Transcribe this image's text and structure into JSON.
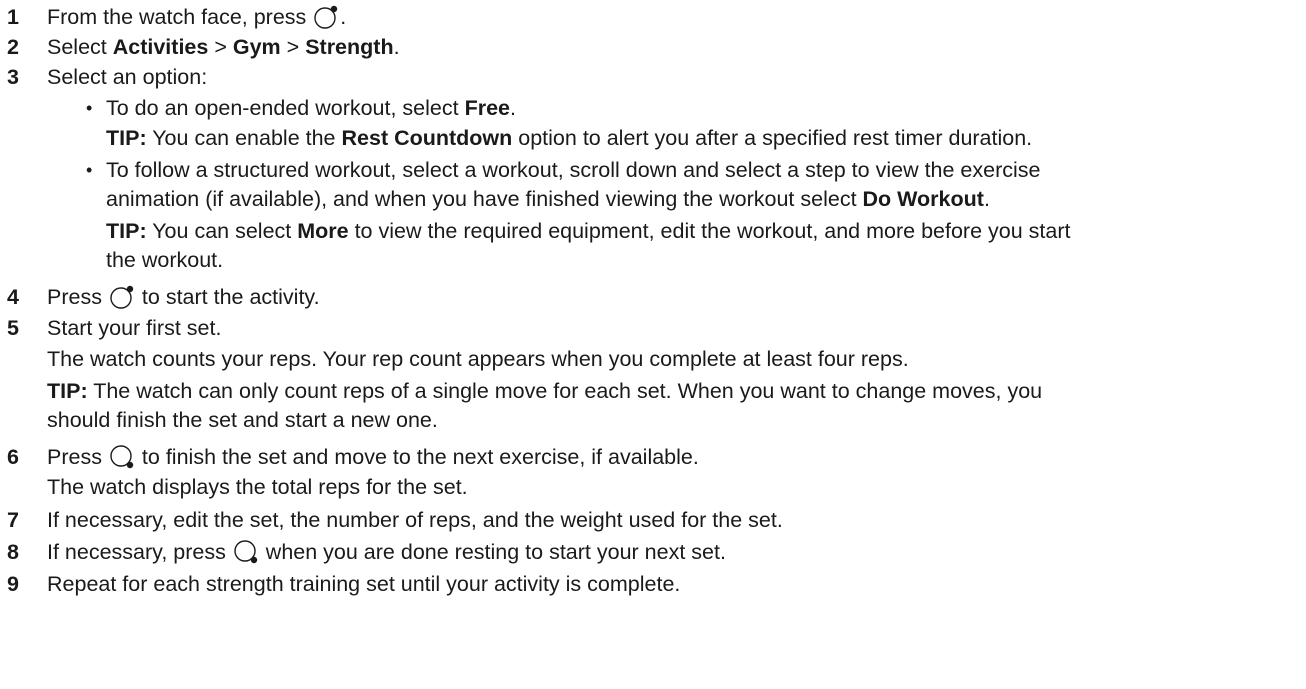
{
  "steps": {
    "s1": {
      "num": "1",
      "before": "From the watch face, press",
      "after": "."
    },
    "s2": {
      "num": "2",
      "t1": "Select ",
      "b1": "Activities",
      "t2": " > ",
      "b2": "Gym",
      "t3": " > ",
      "b3": "Strength",
      "t4": "."
    },
    "s3": {
      "num": "3",
      "text": "Select an option:",
      "bullet_glyph": "•",
      "opt1": {
        "t1": "To do an open-ended workout, select ",
        "b1": "Free",
        "t2": "."
      },
      "tip1": {
        "tip": "TIP:",
        "t1": " You can enable the ",
        "b1": "Rest Countdown",
        "t2": " option to alert you after a specified rest timer duration."
      },
      "opt2": {
        "line1": "To follow a structured workout, select a workout, scroll down and select a step to view the exercise",
        "line2a": "animation (if available), and when you have finished viewing the workout select ",
        "line2b": "Do Workout",
        "line2c": "."
      },
      "tip2": {
        "tip": "TIP:",
        "t1": " You can select ",
        "b1": "More",
        "t2": " to view the required equipment, edit the workout, and more before you start",
        "line2": "the workout."
      }
    },
    "s4": {
      "num": "4",
      "before": "Press",
      "after": " to start the activity."
    },
    "s5": {
      "num": "5",
      "text": "Start your first set.",
      "detail": "The watch counts your reps. Your rep count appears when you complete at least four reps.",
      "tip": "TIP:",
      "tip_line1": " The watch can only count reps of a single move for each set. When you want to change moves, you",
      "tip_line2": "should finish the set and start a new one."
    },
    "s6": {
      "num": "6",
      "before": "Press",
      "after": " to finish the set and move to the next exercise, if available.",
      "detail": "The watch displays the total reps for the set."
    },
    "s7": {
      "num": "7",
      "text": "If necessary, edit the set, the number of reps, and the weight used for the set."
    },
    "s8": {
      "num": "8",
      "before": "If necessary, press",
      "after": " when you are done resting to start your next set."
    },
    "s9": {
      "num": "9",
      "text": "Repeat for each strength training set until your activity is complete."
    }
  },
  "icons": {
    "start_button": "watch-start-stop-button-icon",
    "back_button": "watch-back-lap-button-icon"
  }
}
